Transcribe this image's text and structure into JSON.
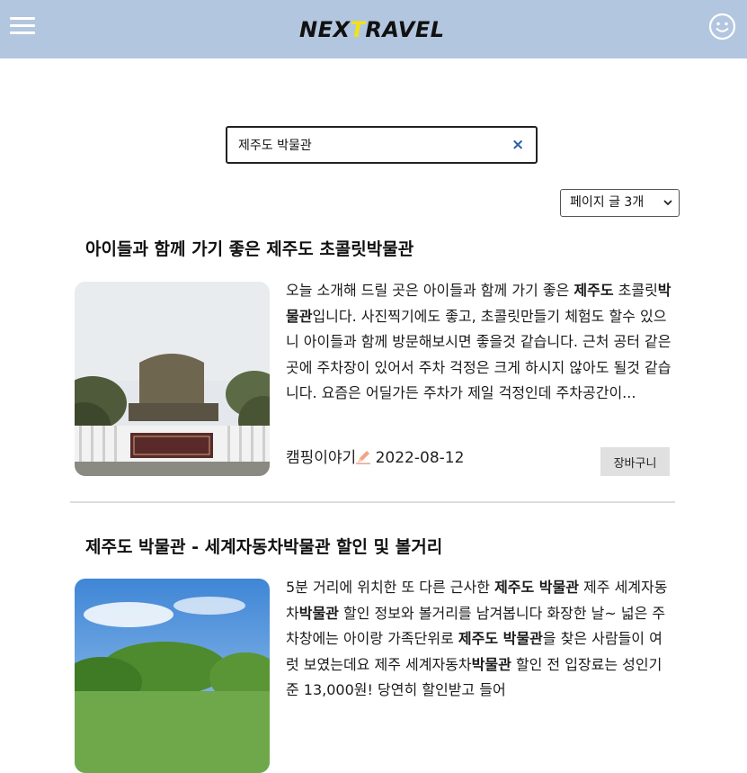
{
  "header": {
    "logo_prefix": "NEX",
    "logo_accent": "T",
    "logo_suffix": "RAVEL",
    "menu_icon": "hamburger-menu-icon",
    "profile_icon": "smiley-face-icon",
    "bg_color": "#b3c6df",
    "accent_color": "#f2e21a"
  },
  "search": {
    "value": "제주도 박물관",
    "clear_icon": "×"
  },
  "page_size": {
    "selected": "페이지 글 3개",
    "chevron": "⌄"
  },
  "posts": [
    {
      "title": "아이들과 함께 가기 좋은 제주도 초콜릿박물관",
      "excerpt_parts": [
        {
          "text": "오늘 소개해 드릴 곳은 아이들과 함께 가기 좋은 ",
          "bold": false
        },
        {
          "text": "제주도",
          "bold": true
        },
        {
          "text": " 초콜릿",
          "bold": false
        },
        {
          "text": "박물관",
          "bold": true
        },
        {
          "text": "입니다. 사진찍기에도 좋고, 초콜릿만들기 체험도 할수 있으니 아이들과 함께 방문해보시면 좋을것 같습니다. 근처 공터 같은곳에 주차장이 있어서 주차 걱정은 크게 하시지 않아도 될것 같습니다. 요즘은 어딜가든 주차가 제일 걱정인데 주차공간이...",
          "bold": false
        }
      ],
      "author": "캠핑이야기",
      "date": "2022-08-12",
      "cart_label": "장바구니"
    },
    {
      "title": "제주도 박물관 - 세계자동차박물관 할인 및 볼거리",
      "excerpt_parts": [
        {
          "text": "5분 거리에 위치한 또 다른 근사한 ",
          "bold": false
        },
        {
          "text": "제주도 박물관",
          "bold": true
        },
        {
          "text": " 제주 세계자동차",
          "bold": false
        },
        {
          "text": "박물관",
          "bold": true
        },
        {
          "text": " 할인 정보와 볼거리를 남겨봅니다 화장한 날~ 넓은 주차창에는 아이랑 가족단위로 ",
          "bold": false
        },
        {
          "text": "제주도 박물관",
          "bold": true
        },
        {
          "text": "을 찾은 사람들이 여럿 보였는데요 제주 세계자동차",
          "bold": false
        },
        {
          "text": "박물관",
          "bold": true
        },
        {
          "text": " 할인 전 입장료는 성인기준 13,000원! 당연히 할인받고 들어",
          "bold": false
        }
      ]
    }
  ]
}
